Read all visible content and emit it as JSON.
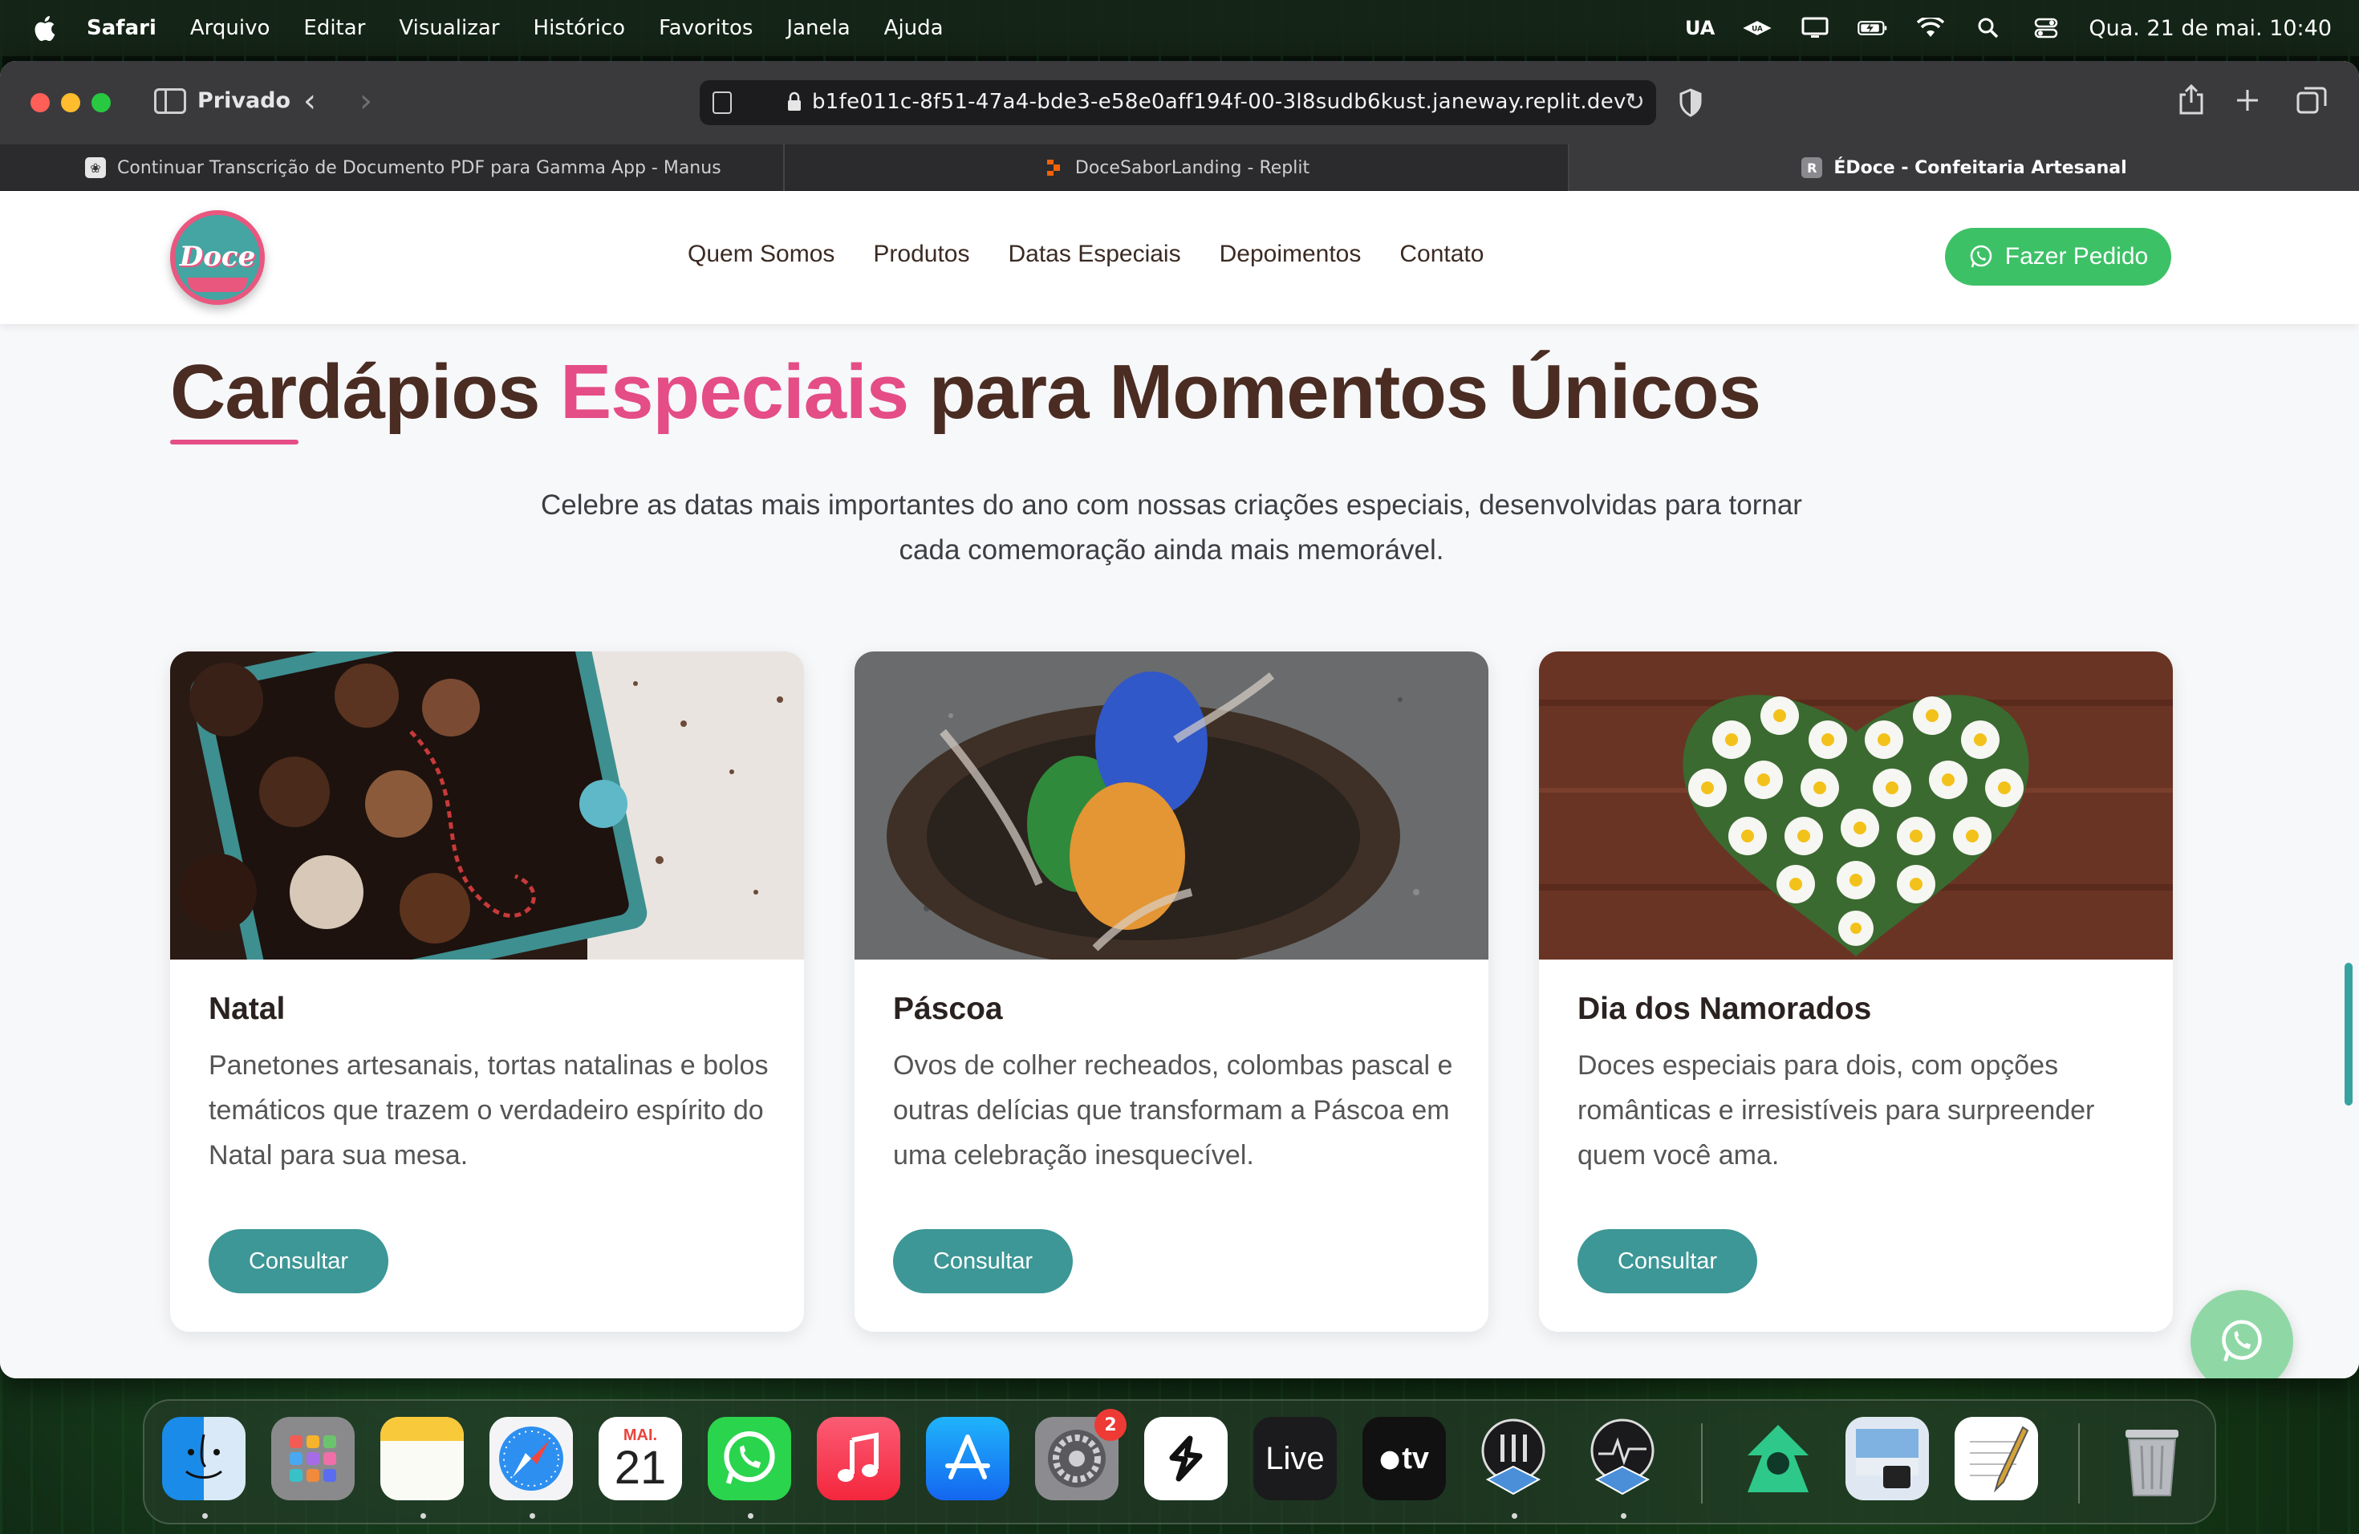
{
  "menubar": {
    "app_name": "Safari",
    "items": [
      "Arquivo",
      "Editar",
      "Visualizar",
      "Histórico",
      "Favoritos",
      "Janela",
      "Ajuda"
    ],
    "status_ua": "UA",
    "clock": "Qua. 21 de mai.  10:40"
  },
  "browser": {
    "private_label": "Privado",
    "url": "b1fe011c-8f51-47a4-bde3-e58e0aff194f-00-3l8sudb6kust.janeway.replit.dev",
    "tabs": [
      {
        "label": "Continuar Transcrição de Documento PDF para Gamma App - Manus",
        "favicon": "manus-icon"
      },
      {
        "label": "DoceSaborLanding - Replit",
        "favicon": "replit-icon"
      },
      {
        "label": "ÉDoce - Confeitaria Artesanal",
        "favicon": "R",
        "active": true
      }
    ]
  },
  "site": {
    "logo_text": "Doce",
    "nav": [
      "Quem Somos",
      "Produtos",
      "Datas Especiais",
      "Depoimentos",
      "Contato"
    ],
    "order_button": "Fazer Pedido",
    "section": {
      "title_part1": "Cardápios ",
      "title_highlight": "Especiais",
      "title_part2": " para Momentos Únicos",
      "subtitle": "Celebre as datas mais importantes do ano com nossas criações especiais, desenvolvidas para tornar cada comemoração ainda mais memorável."
    },
    "cards": [
      {
        "title": "Natal",
        "text": "Panetones artesanais, tortas natalinas e bolos temáticos que trazem o verdadeiro espírito do Natal para sua mesa.",
        "button": "Consultar"
      },
      {
        "title": "Páscoa",
        "text": "Ovos de colher recheados, colombas pascal e outras delícias que transformam a Páscoa em uma celebração inesquecível.",
        "button": "Consultar"
      },
      {
        "title": "Dia dos Namorados",
        "text": "Doces especiais para dois, com opções românticas e irresistíveis para surpreender quem você ama.",
        "button": "Consultar"
      }
    ],
    "accent_colors": {
      "pink": "#e44d86",
      "teal": "#3c9796",
      "green": "#3dc167",
      "brown": "#4a2c22"
    }
  },
  "dock": {
    "apps": [
      "finder-icon",
      "launchpad-icon",
      "notes-icon",
      "safari-icon",
      "calendar-icon",
      "whatsapp-icon",
      "music-icon",
      "app-store-icon",
      "system-settings-icon",
      "shortcut-app-icon",
      "live-icon",
      "apple-tv-icon",
      "ua-console-icon",
      "ua-meter-icon",
      "app-icon",
      "preview-icon",
      "textedit-icon",
      "trash-icon"
    ],
    "calendar_month": "MAI.",
    "calendar_day": "21",
    "settings_badge": "2",
    "live_label": "Live",
    "tv_label": "tv"
  }
}
